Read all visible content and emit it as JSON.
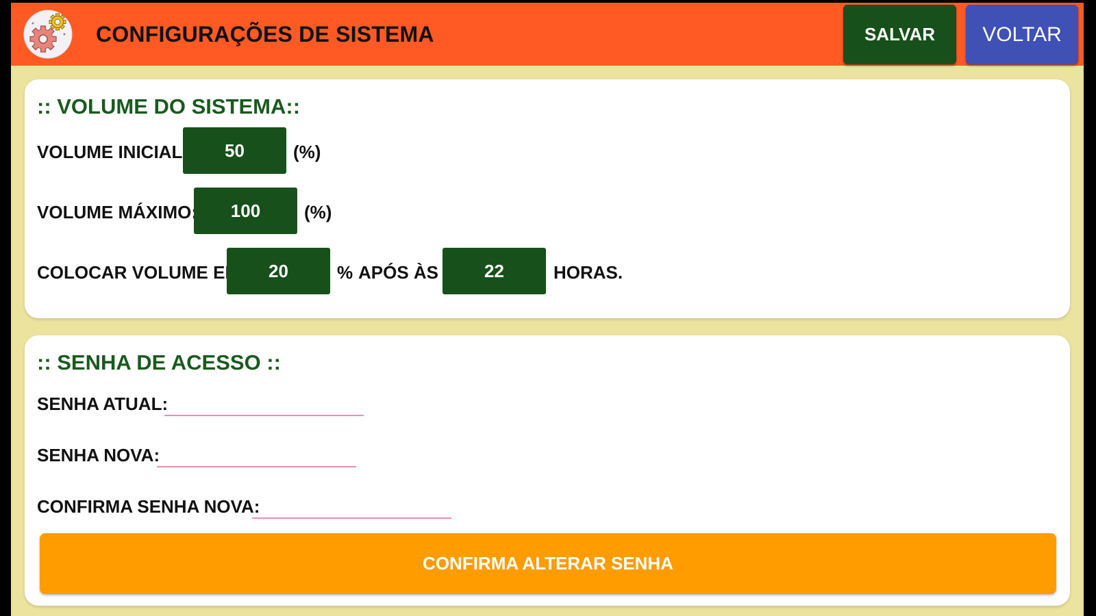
{
  "header": {
    "title": "CONFIGURAÇÕES DE SISTEMA",
    "save_label": "SALVAR",
    "back_label": "VOLTAR",
    "app_icon": "settings-gears-icon"
  },
  "volume": {
    "section_title": ":: VOLUME DO SISTEMA::",
    "initial_label": "VOLUME INICIAL:",
    "initial_value": "50",
    "initial_unit": "(%)",
    "max_label": "VOLUME MÁXIMO:",
    "max_value": "100",
    "max_unit": "(%)",
    "schedule_label": "COLOCAR VOLUME EM",
    "schedule_value": "20",
    "schedule_percent": "%",
    "schedule_after": "APÓS ÀS",
    "schedule_hour": "22",
    "schedule_hours_label": "HORAS."
  },
  "password": {
    "section_title": ":: SENHA DE ACESSO ::",
    "current_label": "SENHA ATUAL:",
    "current_value": "",
    "new_label": "SENHA NOVA:",
    "new_value": "",
    "confirm_label": "CONFIRMA SENHA NOVA:",
    "confirm_value": "",
    "confirm_button": "CONFIRMA ALTERAR SENHA"
  },
  "colors": {
    "topbar": "#ff5a24",
    "background": "#ece39f",
    "green": "#17501a",
    "blue": "#3f51b5",
    "orange": "#ff9c00",
    "field_underline": "#f28ab2"
  }
}
